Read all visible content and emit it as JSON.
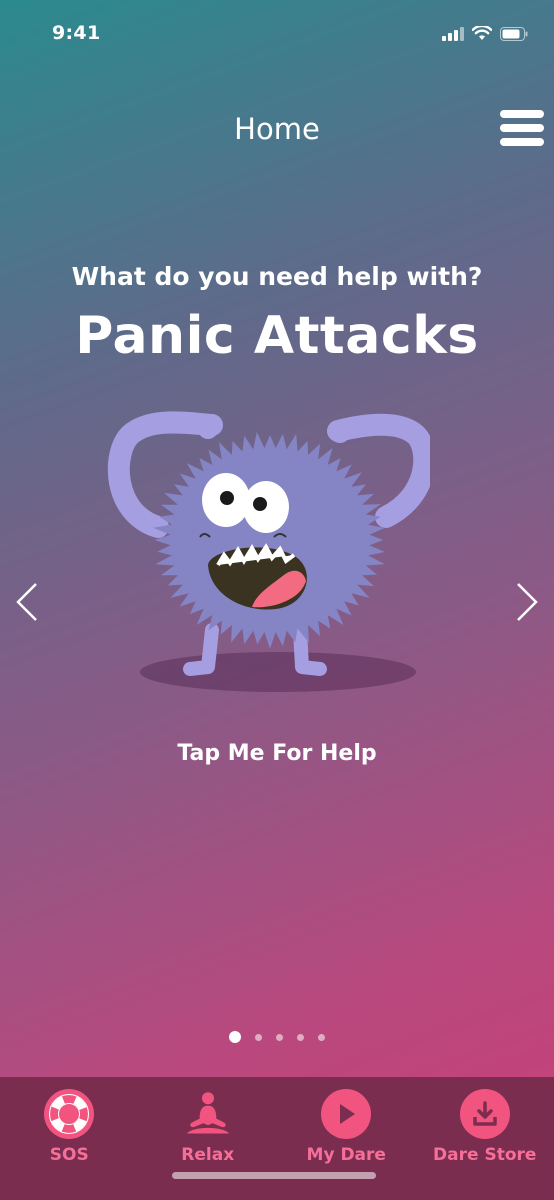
{
  "status_bar": {
    "time": "9:41"
  },
  "nav": {
    "title": "Home"
  },
  "main": {
    "prompt": "What do you need help with?",
    "topic": "Panic Attacks",
    "tap_label": "Tap Me For Help",
    "page_count": 5,
    "active_page": 1
  },
  "tab_bar": {
    "items": [
      {
        "label": "SOS",
        "icon": "lifebuoy-icon"
      },
      {
        "label": "Relax",
        "icon": "meditation-icon"
      },
      {
        "label": "My Dare",
        "icon": "play-icon"
      },
      {
        "label": "Dare Store",
        "icon": "download-icon"
      }
    ]
  },
  "colors": {
    "accent": "#f0547f",
    "tab_label": "#f56f98",
    "tab_bar_bg": "#7b2d50",
    "monster": "#8584c4"
  }
}
